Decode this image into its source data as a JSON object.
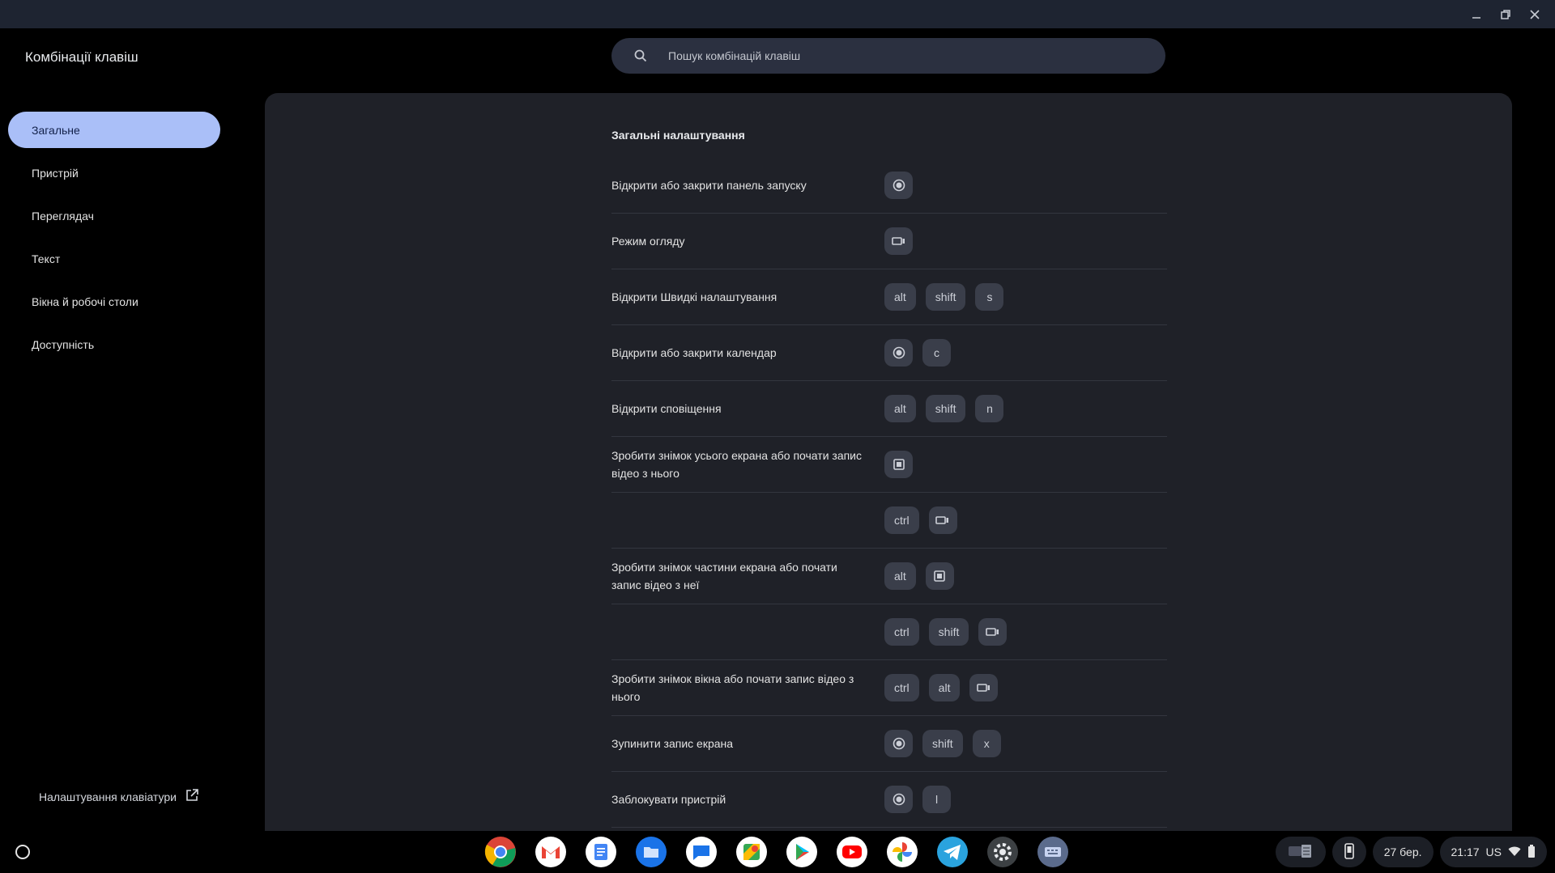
{
  "window": {
    "minimize_icon": "minimize-icon",
    "restore_icon": "restore-icon",
    "close_icon": "close-icon"
  },
  "app": {
    "title": "Комбінації клавіш"
  },
  "search": {
    "placeholder": "Пошук комбінацій клавіш"
  },
  "sidebar": {
    "items": [
      {
        "label": "Загальне",
        "active": true
      },
      {
        "label": "Пристрій",
        "active": false
      },
      {
        "label": "Переглядач",
        "active": false
      },
      {
        "label": "Текст",
        "active": false
      },
      {
        "label": "Вікна й робочі столи",
        "active": false
      },
      {
        "label": "Доступність",
        "active": false
      }
    ],
    "keyboard_settings_label": "Налаштування клавіатури"
  },
  "main": {
    "section_title": "Загальні налаштування",
    "shortcuts": [
      {
        "label": "Відкрити або закрити панель запуску",
        "keys": [
          {
            "icon": "launcher-icon"
          }
        ]
      },
      {
        "label": "Режим огляду",
        "keys": [
          {
            "icon": "overview-icon"
          }
        ]
      },
      {
        "label": "Відкрити Швидкі налаштування",
        "keys": [
          {
            "text": "alt"
          },
          {
            "text": "shift"
          },
          {
            "text": "s"
          }
        ]
      },
      {
        "label": "Відкрити або закрити календар",
        "keys": [
          {
            "icon": "launcher-icon"
          },
          {
            "text": "c"
          }
        ]
      },
      {
        "label": "Відкрити сповіщення",
        "keys": [
          {
            "text": "alt"
          },
          {
            "text": "shift"
          },
          {
            "text": "n"
          }
        ]
      },
      {
        "label": "Зробити знімок усього екрана або почати запис відео з нього",
        "keys": [
          {
            "icon": "screenshot-icon"
          }
        ]
      },
      {
        "label": "",
        "keys": [
          {
            "text": "ctrl"
          },
          {
            "icon": "overview-icon"
          }
        ]
      },
      {
        "label": "Зробити знімок частини екрана або почати запис відео з неї",
        "keys": [
          {
            "text": "alt"
          },
          {
            "icon": "screenshot-icon"
          }
        ]
      },
      {
        "label": "",
        "keys": [
          {
            "text": "ctrl"
          },
          {
            "text": "shift"
          },
          {
            "icon": "overview-icon"
          }
        ]
      },
      {
        "label": "Зробити знімок вікна або почати запис відео з нього",
        "keys": [
          {
            "text": "ctrl"
          },
          {
            "text": "alt"
          },
          {
            "icon": "overview-icon"
          }
        ]
      },
      {
        "label": "Зупинити запис екрана",
        "keys": [
          {
            "icon": "launcher-icon"
          },
          {
            "text": "shift"
          },
          {
            "text": "x"
          }
        ]
      },
      {
        "label": "Заблокувати пристрій",
        "keys": [
          {
            "icon": "launcher-icon"
          },
          {
            "text": "l"
          }
        ]
      }
    ]
  },
  "shelf": {
    "launcher_icon": "launcher-circle-icon",
    "apps": [
      {
        "name": "chrome-app-icon",
        "color": "#e94235"
      },
      {
        "name": "gmail-app-icon",
        "color": "#ffffff"
      },
      {
        "name": "docs-app-icon",
        "color": "#4285f4"
      },
      {
        "name": "files-app-icon",
        "color": "#1a73e8"
      },
      {
        "name": "messages-app-icon",
        "color": "#1a73e8"
      },
      {
        "name": "maps-app-icon",
        "color": "#34a853"
      },
      {
        "name": "play-store-app-icon",
        "color": "#ffffff"
      },
      {
        "name": "youtube-app-icon",
        "color": "#ff0000"
      },
      {
        "name": "photos-app-icon",
        "color": "#fbbc04"
      },
      {
        "name": "telegram-app-icon",
        "color": "#2aa3de"
      },
      {
        "name": "settings-app-icon",
        "color": "#5f6368"
      },
      {
        "name": "shortcuts-app-icon",
        "color": "#5b6b8c"
      }
    ],
    "date": "27 бер.",
    "time": "21:17",
    "locale": "US"
  },
  "colors": {
    "accent": "#aabff8",
    "panel": "#1f2128",
    "key_bg": "#3a3e4a",
    "titlebar": "#1e2431"
  }
}
